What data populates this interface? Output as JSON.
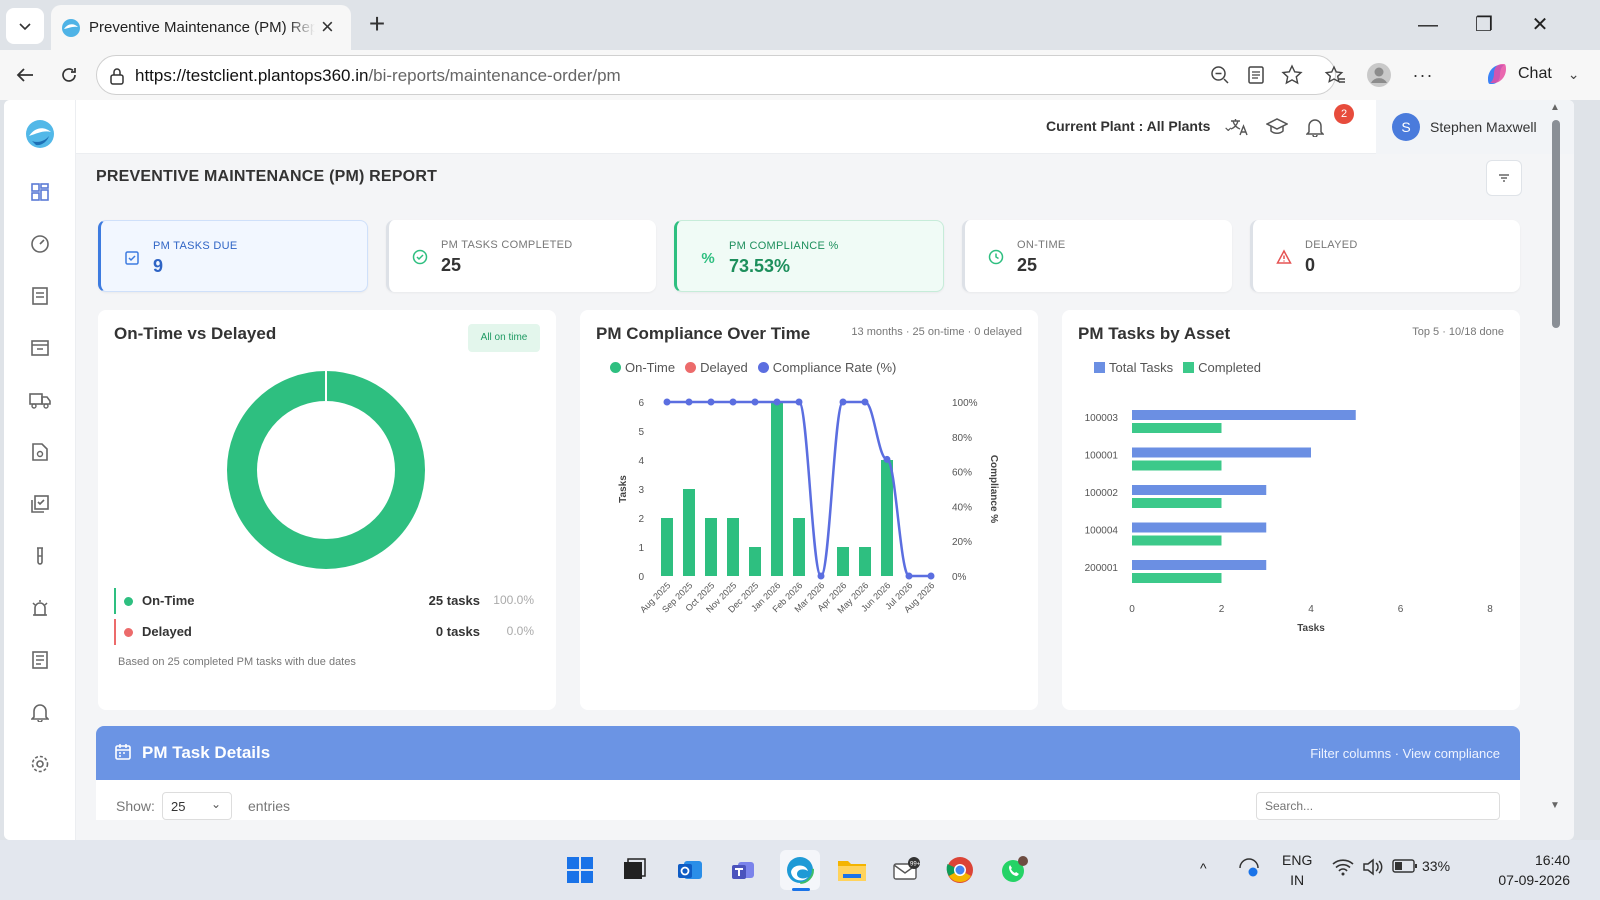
{
  "browser": {
    "tab_title": "Preventive Maintenance (PM) Report",
    "url_host": "https://testclient.plantops360.in",
    "url_path": "/bi-reports/maintenance-order/pm",
    "chat_label": "Chat"
  },
  "header": {
    "plant_label": "Current Plant : All Plants",
    "notification_count": "2",
    "user_initial": "S",
    "user_name": "Stephen Maxwell"
  },
  "page_title": "PREVENTIVE MAINTENANCE (PM) REPORT",
  "kpis": [
    {
      "label": "PM TASKS DUE",
      "value": "9",
      "icon": "checkbox-icon"
    },
    {
      "label": "PM TASKS COMPLETED",
      "value": "25",
      "icon": "check-circle-icon"
    },
    {
      "label": "PM COMPLIANCE %",
      "value": "73.53%",
      "icon": "percent-icon"
    },
    {
      "label": "ON-TIME",
      "value": "25",
      "icon": "clock-icon"
    },
    {
      "label": "DELAYED",
      "value": "0",
      "icon": "warning-icon"
    }
  ],
  "ontime_card": {
    "title": "On-Time vs Delayed",
    "pill": "All on time",
    "rows": [
      {
        "name": "On-Time",
        "count": "25 tasks",
        "pct": "100.0%",
        "color": "#2ebf80"
      },
      {
        "name": "Delayed",
        "count": "0 tasks",
        "pct": "0.0%",
        "color": "#ec6b6b"
      }
    ],
    "note": "Based on 25 completed PM tasks with due dates"
  },
  "compliance_card": {
    "title": "PM Compliance Over Time",
    "subtitle": "13 months · 25 on-time · 0 delayed",
    "legend": [
      "On-Time",
      "Delayed",
      "Compliance Rate (%)"
    ]
  },
  "asset_card": {
    "title": "PM Tasks by Asset",
    "subtitle": "Top 5 · 10/18 done",
    "legend": [
      "Total Tasks",
      "Completed"
    ]
  },
  "chart_data": [
    {
      "type": "pie",
      "title": "On-Time vs Delayed",
      "categories": [
        "On-Time",
        "Delayed"
      ],
      "values": [
        25,
        0
      ],
      "colors": [
        "#2ebf80",
        "#ec6b6b"
      ]
    },
    {
      "type": "bar",
      "title": "PM Compliance Over Time",
      "categories": [
        "Aug 2025",
        "Sep 2025",
        "Oct 2025",
        "Nov 2025",
        "Dec 2025",
        "Jan 2026",
        "Feb 2026",
        "Mar 2026",
        "Apr 2026",
        "May 2026",
        "Jun 2026",
        "Jul 2026",
        "Aug 2026"
      ],
      "series": [
        {
          "name": "On-Time",
          "values": [
            2,
            3,
            2,
            2,
            1,
            6,
            2,
            0,
            1,
            1,
            4,
            0,
            0
          ],
          "color": "#2ebf80"
        },
        {
          "name": "Delayed",
          "values": [
            0,
            0,
            0,
            0,
            0,
            0,
            0,
            0,
            0,
            0,
            0,
            0,
            0
          ],
          "color": "#ec6b6b"
        },
        {
          "name": "Compliance Rate (%)",
          "values": [
            100,
            100,
            100,
            100,
            100,
            100,
            100,
            0,
            100,
            100,
            67,
            0,
            0
          ],
          "color": "#5b6ee0",
          "axis": "right"
        }
      ],
      "ylabel": "Tasks",
      "y2label": "Compliance %",
      "ylim": [
        0,
        6
      ],
      "yticks": [
        "0",
        "1",
        "2",
        "3",
        "4",
        "5",
        "6"
      ],
      "y2lim": [
        0,
        100
      ],
      "y2ticks": [
        "0%",
        "20%",
        "40%",
        "60%",
        "80%",
        "100%"
      ]
    },
    {
      "type": "bar",
      "orientation": "horizontal",
      "title": "PM Tasks by Asset",
      "categories": [
        "100003",
        "100001",
        "100002",
        "100004",
        "200001"
      ],
      "series": [
        {
          "name": "Total Tasks",
          "values": [
            5,
            4,
            3,
            3,
            3
          ],
          "color": "#6b8fe3"
        },
        {
          "name": "Completed",
          "values": [
            2,
            2,
            2,
            2,
            2
          ],
          "color": "#3cc98a"
        }
      ],
      "xlabel": "Tasks",
      "xlim": [
        0,
        8
      ],
      "xticks": [
        "0",
        "2",
        "4",
        "6",
        "8"
      ]
    }
  ],
  "details": {
    "title": "PM Task Details",
    "links": "Filter columns · View compliance",
    "show_label": "Show:",
    "show_value": "25",
    "entries_label": "entries",
    "search_placeholder": "Search..."
  },
  "taskbar": {
    "lang_line1": "ENG",
    "lang_line2": "IN",
    "battery": "33%",
    "time": "16:40",
    "date": "07-09-2026"
  },
  "colors": {
    "accent_blue": "#6b94e4",
    "green": "#2ebf80",
    "red": "#ec6b6b"
  }
}
